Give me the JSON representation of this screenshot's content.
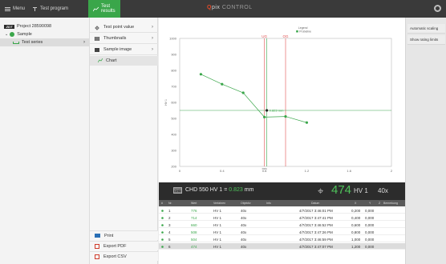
{
  "topbar": {
    "menu_label": "Menu",
    "test_program_label": "Test program",
    "test_results_label": "Test results",
    "brand_prefix": "Q",
    "brand_name": "pix",
    "brand_suffix": "CONTROL",
    "active_color": "#3aa64a"
  },
  "tree": {
    "project": "Project 28590098",
    "project_logo": "ZDT",
    "sample": "Sample",
    "series": "Test series"
  },
  "menu": {
    "items": [
      {
        "label": "Test point value",
        "icon": "crosshair-icon"
      },
      {
        "label": "Thumbnails",
        "icon": "grid-icon"
      },
      {
        "label": "Sample image",
        "icon": "image-icon"
      }
    ],
    "submenu": "Chart",
    "print": "Print",
    "export_pdf": "Export PDF",
    "export_csv": "Export CSV"
  },
  "right_panel": {
    "automatic_scaling": "Automatic scaling",
    "show_rating_limits": "Show rating limits"
  },
  "chart_data": {
    "type": "line",
    "legend_title": "Legend",
    "series": [
      {
        "name": "Probeline",
        "x": [
          0.2,
          0.4,
          0.6,
          0.8,
          1.0,
          1.2
        ],
        "y": [
          776,
          714,
          660,
          508,
          512,
          474
        ]
      }
    ],
    "ylim": [
      200,
      1000
    ],
    "xlim": [
      0,
      2
    ],
    "yticks": [
      200,
      300,
      400,
      500,
      600,
      700,
      800,
      900,
      1000
    ],
    "xticks": [
      0,
      0.4,
      0.8,
      1.2,
      1.6,
      2
    ],
    "ylabel": "HV 1",
    "xlabel": "mm",
    "limit_labels": [
      "UG",
      "OG"
    ],
    "limit_x": [
      0.8,
      1.0
    ],
    "point_annotation": "0.823 mm",
    "grid": false,
    "legend_placement": "top-right"
  },
  "measurement": {
    "icon_text": "CHD",
    "label": "CHD 550 HV 1 =",
    "value": "0.823",
    "unit": "mm",
    "big_value": "474",
    "big_unit": "HV 1",
    "objective": "40x"
  },
  "table": {
    "headers": [
      "#",
      "Nr.",
      "Wert",
      "Verfahren",
      "Objektiv",
      "Info",
      "Datum",
      "X",
      "Y",
      "Z",
      "Bemerkung"
    ],
    "rows": [
      {
        "nr": "1",
        "value": "776",
        "method": "HV 1",
        "obj": "40x",
        "date": "4/7/2017 3:46:01 PM",
        "x": "0,200",
        "y": "0,000"
      },
      {
        "nr": "2",
        "value": "714",
        "method": "HV 1",
        "obj": "40x",
        "date": "4/7/2017 3:47:41 PM",
        "x": "0,400",
        "y": "0,000"
      },
      {
        "nr": "3",
        "value": "660",
        "method": "HV 1",
        "obj": "40x",
        "date": "4/7/2017 3:46:52 PM",
        "x": "0,600",
        "y": "0,000"
      },
      {
        "nr": "4",
        "value": "508",
        "method": "HV 1",
        "obj": "40x",
        "date": "4/7/2017 3:47:26 PM",
        "x": "0,800",
        "y": "0,000"
      },
      {
        "nr": "5",
        "value": "504",
        "method": "HV 1",
        "obj": "40x",
        "date": "4/7/2017 3:46:59 PM",
        "x": "1,000",
        "y": "0,000"
      },
      {
        "nr": "6",
        "value": "474",
        "method": "HV 1",
        "obj": "40x",
        "date": "4/7/2017 3:47:07 PM",
        "x": "1,200",
        "y": "0,000"
      }
    ]
  }
}
